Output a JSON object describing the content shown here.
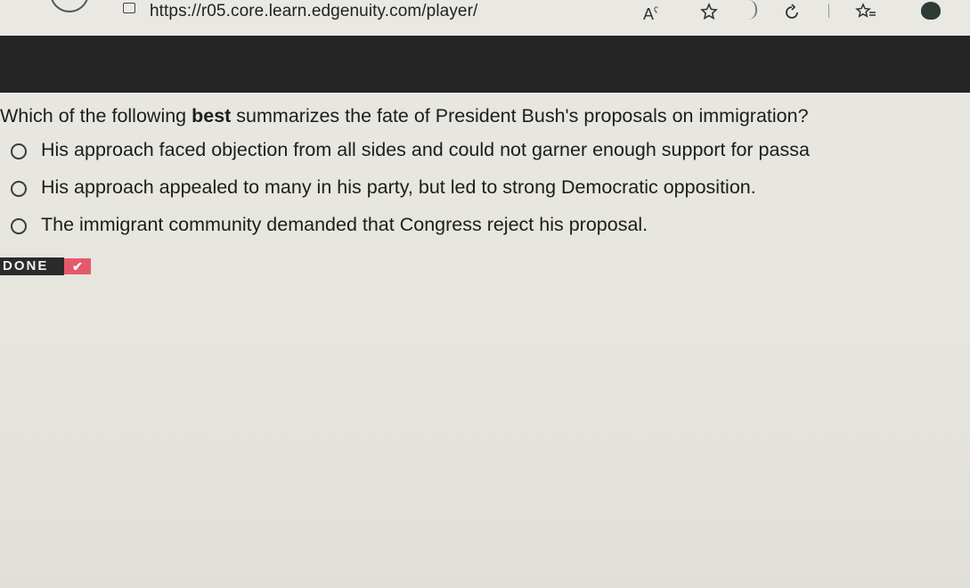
{
  "browser": {
    "url": "https://r05.core.learn.edgenuity.com/player/",
    "read_aloud_glyph": "A",
    "read_aloud_sup": "ʕ"
  },
  "question": {
    "prefix": "Which of the following ",
    "bold": "best",
    "suffix": " summarizes the fate of President Bush's proposals on immigration?"
  },
  "options": [
    {
      "text": "His approach faced objection from all sides and could not garner enough support for passa"
    },
    {
      "text": "His approach appealed to many in his party, but led to strong Democratic opposition."
    },
    {
      "text": "The immigrant community demanded that Congress reject his proposal."
    }
  ],
  "status": {
    "done_label": "DONE",
    "check_glyph": "✔",
    "check_color": "#e45a6a"
  },
  "icons": {
    "page": "page-info-icon",
    "read_aloud": "read-aloud-icon",
    "favorite": "star-icon",
    "refresh": "refresh-icon",
    "favorites": "favorites-list-icon",
    "profile": "profile-icon"
  }
}
